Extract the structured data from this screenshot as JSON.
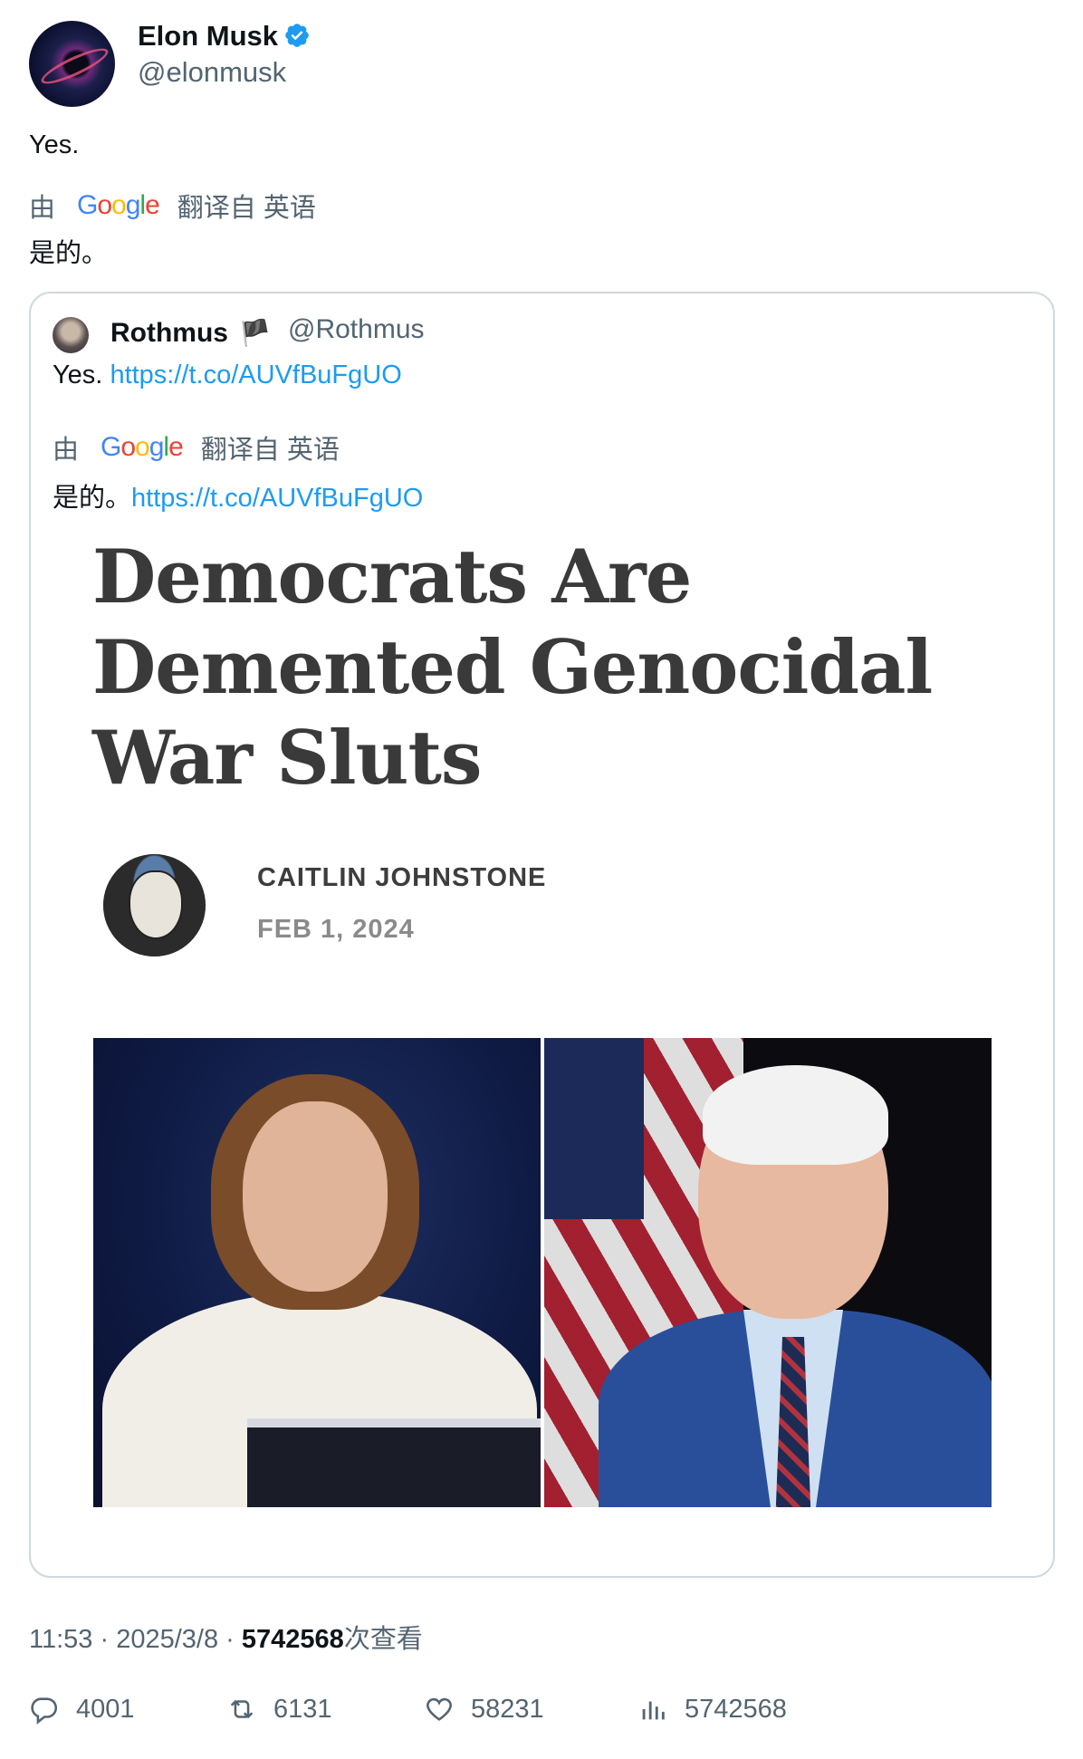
{
  "author": {
    "name": "Elon Musk",
    "handle": "@elonmusk",
    "verified": true,
    "verified_color": "#1d9bf0"
  },
  "tweet": {
    "text": "Yes.",
    "translation": {
      "prefix": "由",
      "provider_letters": [
        "G",
        "o",
        "o",
        "g",
        "l",
        "e"
      ],
      "suffix": "翻译自 英语",
      "text": "是的。"
    }
  },
  "quote": {
    "name": "Rothmus",
    "flag": "🏴",
    "handle": "@Rothmus",
    "text": "Yes. ",
    "link": "https://t.co/AUVfBuFgUO",
    "translation": {
      "prefix": "由",
      "suffix": "翻译自 英语",
      "text": "是的。",
      "link": "https://t.co/AUVfBuFgUO"
    },
    "article": {
      "headline_lines": [
        "Democrats Are",
        "Demented Genocidal",
        "War Sluts"
      ],
      "author": "CAITLIN JOHNSTONE",
      "date": "FEB 1, 2024"
    }
  },
  "meta": {
    "time": "11:53",
    "separator": "·",
    "date": "2025/3/8",
    "views": "5742568",
    "views_suffix": "次查看"
  },
  "actions": {
    "replies": "4001",
    "reposts": "6131",
    "likes": "58231",
    "views": "5742568"
  },
  "icons": [
    "verified-badge-icon",
    "google-logo",
    "flag-icon",
    "reply-icon",
    "repost-icon",
    "like-icon",
    "views-icon"
  ]
}
